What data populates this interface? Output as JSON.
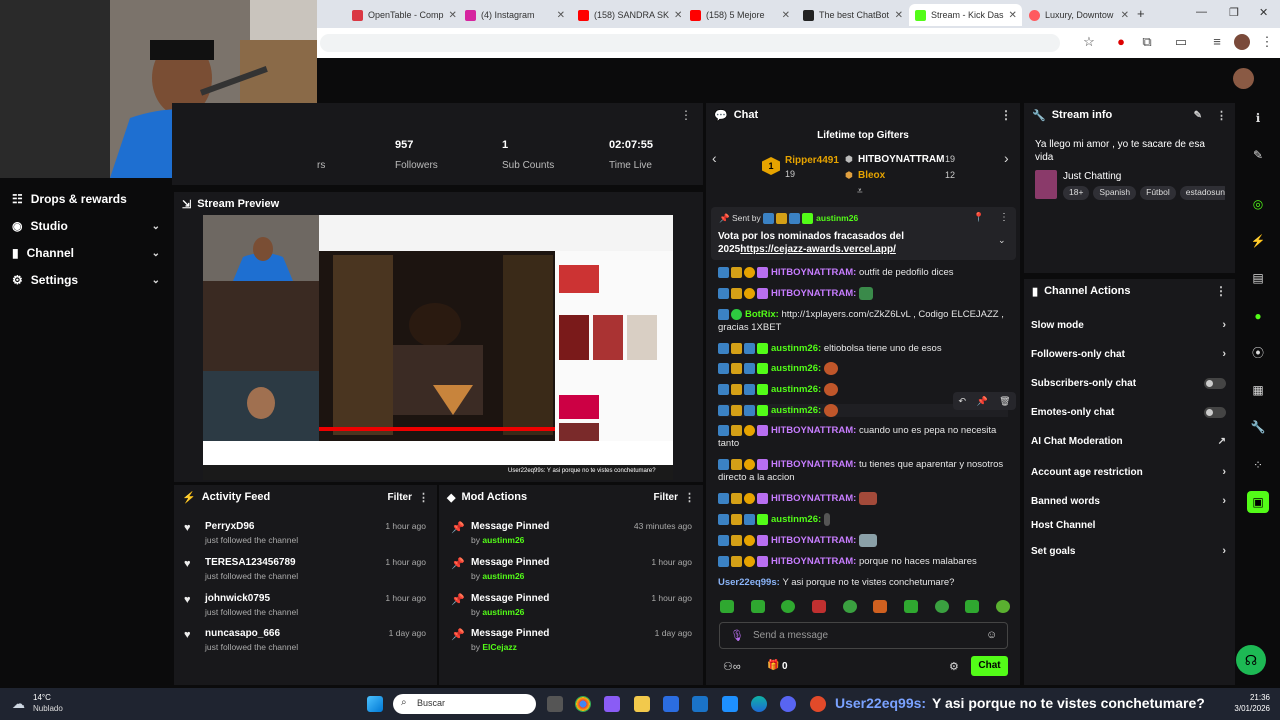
{
  "browser": {
    "tabs": [
      {
        "label": "OpenTable - Comp",
        "color": "#da3743"
      },
      {
        "label": "(4) Instagram",
        "color": "#d6249f"
      },
      {
        "label": "(158) SANDRA SK",
        "color": "#ff0000"
      },
      {
        "label": "(158) 5 Mejore",
        "color": "#ff0000"
      },
      {
        "label": "The best ChatBot",
        "color": "#222222"
      },
      {
        "label": "Stream - Kick Das",
        "color": "#53fc18"
      },
      {
        "label": "Luxury, Downtow",
        "color": "#ff5a5f"
      }
    ],
    "new_tab": "+"
  },
  "stats": [
    {
      "value": "957",
      "label": "Followers"
    },
    {
      "value": "1",
      "label": "Sub Counts"
    },
    {
      "value": "02:07:55",
      "label": "Time Live"
    }
  ],
  "stats_partial_label": "rs",
  "sidebar": {
    "items": [
      {
        "label": "Drops & rewards",
        "icon": "drops-icon"
      },
      {
        "label": "Studio",
        "icon": "studio-icon"
      },
      {
        "label": "Channel",
        "icon": "channel-icon"
      },
      {
        "label": "Settings",
        "icon": "gear-icon"
      }
    ]
  },
  "stream_preview": {
    "title": "Stream Preview",
    "overlay_caption": "User22eq99s: Y asi porque no te vistes conchetumare?"
  },
  "chat": {
    "title": "Chat",
    "gifters": {
      "title": "Lifetime top Gifters",
      "first": {
        "rank": "1",
        "name": "Ripper4491",
        "count": "19"
      },
      "second": {
        "name": "HITBOYNATTRAM",
        "count": "19"
      },
      "third": {
        "name": "Bleox",
        "count": "12"
      }
    },
    "pinned": {
      "sent_by_label": "Sent by",
      "sender": "austinm26",
      "text": "Vota por los nominados fracasados del 2025",
      "link": "https://cejazz-awards.vercel.app/"
    },
    "messages": [
      {
        "user": "HITBOYNATTRAM",
        "text": "outfit de pedofilo dices"
      },
      {
        "user": "HITBOYNATTRAM",
        "text": ""
      },
      {
        "user": "BotRix",
        "text": "http://1xplayers.com/cZkZ6LvL , Codigo ELCEJAZZ , gracias 1XBET"
      },
      {
        "user": "austinm26",
        "text": "eltiobolsa tiene uno de esos"
      },
      {
        "user": "austinm26",
        "text": ""
      },
      {
        "user": "austinm26",
        "text": ""
      },
      {
        "user": "austinm26",
        "text": ""
      },
      {
        "user": "HITBOYNATTRAM",
        "text": "cuando uno es pepa no necesita tanto"
      },
      {
        "user": "HITBOYNATTRAM",
        "text": "tu tienes que aparentar y nosotros directo a la accion"
      },
      {
        "user": "HITBOYNATTRAM",
        "text": ""
      },
      {
        "user": "austinm26",
        "text": ""
      },
      {
        "user": "HITBOYNATTRAM",
        "text": ""
      },
      {
        "user": "HITBOYNATTRAM",
        "text": "porque no haces malabares"
      },
      {
        "user": "User22eq99s",
        "text": "Y asi porque no te vistes conchetumare?"
      }
    ],
    "input_placeholder": "Send a message",
    "points": "0",
    "send_label": "Chat"
  },
  "stream_info": {
    "title": "Stream info",
    "stream_title": "Ya llego mi amor , yo te sacare de esa vida",
    "category": "Just Chatting",
    "tags": [
      "18+",
      "Spanish",
      "Fútbol",
      "estadosun"
    ]
  },
  "channel_actions": {
    "title": "Channel Actions",
    "items": [
      {
        "label": "Slow mode",
        "control": "arrow"
      },
      {
        "label": "Followers-only chat",
        "control": "arrow"
      },
      {
        "label": "Subscribers-only chat",
        "control": "toggle"
      },
      {
        "label": "Emotes-only chat",
        "control": "toggle"
      },
      {
        "label": "AI Chat Moderation",
        "control": "external"
      },
      {
        "label": "Account age restriction",
        "control": "arrow"
      },
      {
        "label": "Banned words",
        "control": "arrow"
      },
      {
        "label": "Host Channel",
        "control": "none"
      },
      {
        "label": "Set goals",
        "control": "arrow"
      }
    ]
  },
  "activity_feed": {
    "title": "Activity Feed",
    "filter": "Filter",
    "items": [
      {
        "name": "PerryxD96",
        "sub": "just followed the channel",
        "time": "1 hour ago"
      },
      {
        "name": "TERESA123456789",
        "sub": "just followed the channel",
        "time": "1 hour ago"
      },
      {
        "name": "johnwick0795",
        "sub": "just followed the channel",
        "time": "1 hour ago"
      },
      {
        "name": "nuncasapo_666",
        "sub": "just followed the channel",
        "time": "1 day ago"
      }
    ]
  },
  "mod_actions": {
    "title": "Mod Actions",
    "filter": "Filter",
    "items": [
      {
        "name": "Message Pinned",
        "by": "by",
        "user": "austinm26",
        "time": "43 minutes ago"
      },
      {
        "name": "Message Pinned",
        "by": "by",
        "user": "austinm26",
        "time": "1 hour ago"
      },
      {
        "name": "Message Pinned",
        "by": "by",
        "user": "austinm26",
        "time": "1 hour ago"
      },
      {
        "name": "Message Pinned",
        "by": "by",
        "user": "ElCejazz",
        "time": "1 day ago"
      }
    ]
  },
  "taskbar": {
    "weather_temp": "14°C",
    "weather_desc": "Nublado",
    "search_placeholder": "Buscar",
    "ticker_user": "User22eq99s:",
    "ticker_text": "Y asi porque no te vistes conchetumare?",
    "time": "21:36",
    "date": "3/01/2026"
  },
  "colors": {
    "accent": "#53fc18",
    "panel": "#18181b",
    "bg": "#0b0b0c"
  }
}
